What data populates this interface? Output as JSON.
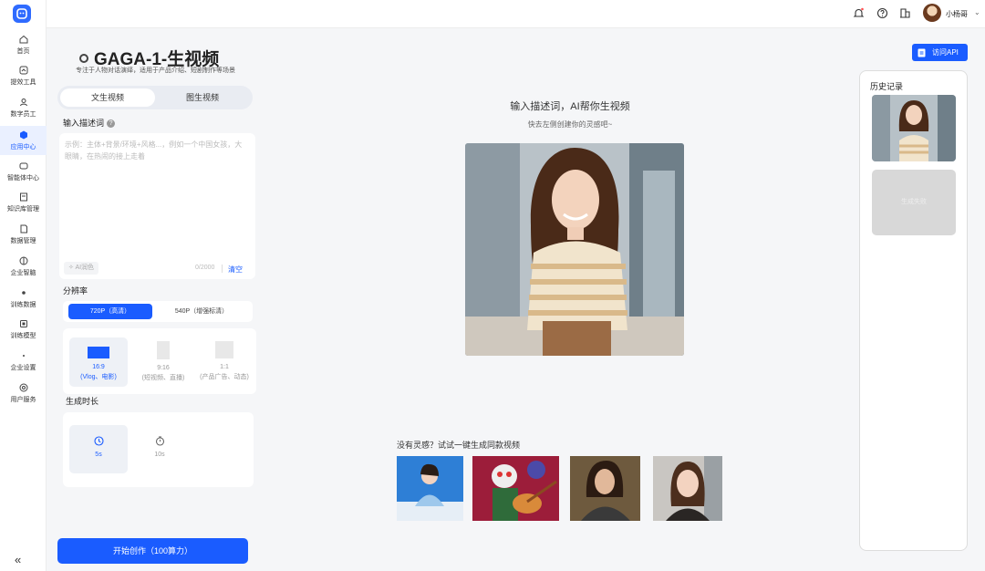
{
  "nav": {
    "items": [
      {
        "label": "首页",
        "icon": "home-icon"
      },
      {
        "label": "提效工具",
        "icon": "tools-icon"
      },
      {
        "label": "数字员工",
        "icon": "digital-employee-icon"
      },
      {
        "label": "应用中心",
        "icon": "app-center-icon",
        "active": true
      },
      {
        "label": "智能体中心",
        "icon": "agent-icon"
      },
      {
        "label": "知识库管理",
        "icon": "knowledge-icon"
      },
      {
        "label": "数据管理",
        "icon": "data-icon"
      },
      {
        "label": "企业智脑",
        "icon": "brain-icon"
      },
      {
        "label": "训练数据",
        "icon": "train-data-icon"
      },
      {
        "label": "训练模型",
        "icon": "train-model-icon"
      },
      {
        "label": "企业设置",
        "icon": "settings-icon"
      },
      {
        "label": "用户服务",
        "icon": "service-icon"
      }
    ],
    "collapse": "«"
  },
  "topbar": {
    "username": "小杨哥",
    "chevron": "⌄"
  },
  "page": {
    "title": "GAGA-1-生视频",
    "subtitle": "专注于人物对话演绎，适用于产品介绍、短剧制作等场景",
    "tabs": [
      "文生视频",
      "图生视频"
    ],
    "prompt_label": "输入描述词",
    "help": "?",
    "placeholder": "示例：主体+背景/环境+风格...，例如一个中国女孩，大眼睛，在热闹的接上走着",
    "ai_polish": "AI润色",
    "counter": "0/2000",
    "clear": "清空",
    "resolution_label": "分辨率",
    "resolutions": [
      "720P（高清）",
      "540P（增强标清）"
    ],
    "ratios": [
      {
        "ratio": "16:9",
        "desc": "(Vlog、电影)"
      },
      {
        "ratio": "9:16",
        "desc": "(短视频、直播)"
      },
      {
        "ratio": "1:1",
        "desc": "(产品广告、动态)"
      }
    ],
    "duration_label": "生成时长",
    "durations": [
      "5s",
      "10s"
    ],
    "start": "开始创作（100算力）"
  },
  "main": {
    "api_button": "访问API",
    "title": "输入描述词，AI帮你生视频",
    "sub": "快去左侧创建你的灵感吧~",
    "inspire": "没有灵感？试试一键生成同款视频"
  },
  "history": {
    "title": "历史记录",
    "failed": "生成失败"
  },
  "colors": {
    "accent": "#1a5cff",
    "active_bg": "#eaf0ff"
  }
}
